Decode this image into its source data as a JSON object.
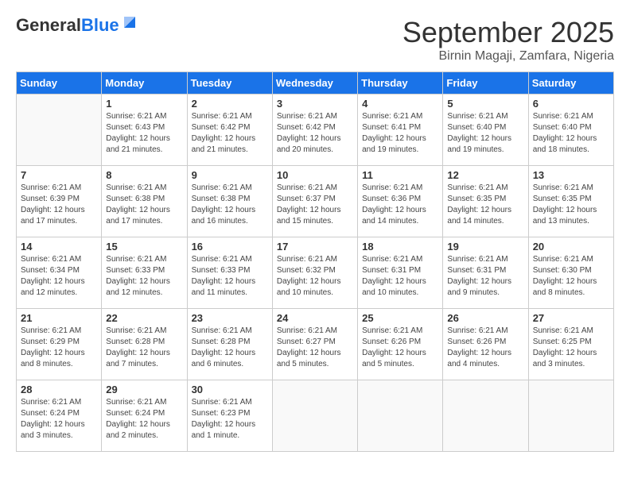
{
  "logo": {
    "line1": "General",
    "line2": "Blue"
  },
  "title": "September 2025",
  "subtitle": "Birnin Magaji, Zamfara, Nigeria",
  "weekdays": [
    "Sunday",
    "Monday",
    "Tuesday",
    "Wednesday",
    "Thursday",
    "Friday",
    "Saturday"
  ],
  "weeks": [
    [
      {
        "day": "",
        "info": ""
      },
      {
        "day": "1",
        "info": "Sunrise: 6:21 AM\nSunset: 6:43 PM\nDaylight: 12 hours\nand 21 minutes."
      },
      {
        "day": "2",
        "info": "Sunrise: 6:21 AM\nSunset: 6:42 PM\nDaylight: 12 hours\nand 21 minutes."
      },
      {
        "day": "3",
        "info": "Sunrise: 6:21 AM\nSunset: 6:42 PM\nDaylight: 12 hours\nand 20 minutes."
      },
      {
        "day": "4",
        "info": "Sunrise: 6:21 AM\nSunset: 6:41 PM\nDaylight: 12 hours\nand 19 minutes."
      },
      {
        "day": "5",
        "info": "Sunrise: 6:21 AM\nSunset: 6:40 PM\nDaylight: 12 hours\nand 19 minutes."
      },
      {
        "day": "6",
        "info": "Sunrise: 6:21 AM\nSunset: 6:40 PM\nDaylight: 12 hours\nand 18 minutes."
      }
    ],
    [
      {
        "day": "7",
        "info": "Sunrise: 6:21 AM\nSunset: 6:39 PM\nDaylight: 12 hours\nand 17 minutes."
      },
      {
        "day": "8",
        "info": "Sunrise: 6:21 AM\nSunset: 6:38 PM\nDaylight: 12 hours\nand 17 minutes."
      },
      {
        "day": "9",
        "info": "Sunrise: 6:21 AM\nSunset: 6:38 PM\nDaylight: 12 hours\nand 16 minutes."
      },
      {
        "day": "10",
        "info": "Sunrise: 6:21 AM\nSunset: 6:37 PM\nDaylight: 12 hours\nand 15 minutes."
      },
      {
        "day": "11",
        "info": "Sunrise: 6:21 AM\nSunset: 6:36 PM\nDaylight: 12 hours\nand 14 minutes."
      },
      {
        "day": "12",
        "info": "Sunrise: 6:21 AM\nSunset: 6:35 PM\nDaylight: 12 hours\nand 14 minutes."
      },
      {
        "day": "13",
        "info": "Sunrise: 6:21 AM\nSunset: 6:35 PM\nDaylight: 12 hours\nand 13 minutes."
      }
    ],
    [
      {
        "day": "14",
        "info": "Sunrise: 6:21 AM\nSunset: 6:34 PM\nDaylight: 12 hours\nand 12 minutes."
      },
      {
        "day": "15",
        "info": "Sunrise: 6:21 AM\nSunset: 6:33 PM\nDaylight: 12 hours\nand 12 minutes."
      },
      {
        "day": "16",
        "info": "Sunrise: 6:21 AM\nSunset: 6:33 PM\nDaylight: 12 hours\nand 11 minutes."
      },
      {
        "day": "17",
        "info": "Sunrise: 6:21 AM\nSunset: 6:32 PM\nDaylight: 12 hours\nand 10 minutes."
      },
      {
        "day": "18",
        "info": "Sunrise: 6:21 AM\nSunset: 6:31 PM\nDaylight: 12 hours\nand 10 minutes."
      },
      {
        "day": "19",
        "info": "Sunrise: 6:21 AM\nSunset: 6:31 PM\nDaylight: 12 hours\nand 9 minutes."
      },
      {
        "day": "20",
        "info": "Sunrise: 6:21 AM\nSunset: 6:30 PM\nDaylight: 12 hours\nand 8 minutes."
      }
    ],
    [
      {
        "day": "21",
        "info": "Sunrise: 6:21 AM\nSunset: 6:29 PM\nDaylight: 12 hours\nand 8 minutes."
      },
      {
        "day": "22",
        "info": "Sunrise: 6:21 AM\nSunset: 6:28 PM\nDaylight: 12 hours\nand 7 minutes."
      },
      {
        "day": "23",
        "info": "Sunrise: 6:21 AM\nSunset: 6:28 PM\nDaylight: 12 hours\nand 6 minutes."
      },
      {
        "day": "24",
        "info": "Sunrise: 6:21 AM\nSunset: 6:27 PM\nDaylight: 12 hours\nand 5 minutes."
      },
      {
        "day": "25",
        "info": "Sunrise: 6:21 AM\nSunset: 6:26 PM\nDaylight: 12 hours\nand 5 minutes."
      },
      {
        "day": "26",
        "info": "Sunrise: 6:21 AM\nSunset: 6:26 PM\nDaylight: 12 hours\nand 4 minutes."
      },
      {
        "day": "27",
        "info": "Sunrise: 6:21 AM\nSunset: 6:25 PM\nDaylight: 12 hours\nand 3 minutes."
      }
    ],
    [
      {
        "day": "28",
        "info": "Sunrise: 6:21 AM\nSunset: 6:24 PM\nDaylight: 12 hours\nand 3 minutes."
      },
      {
        "day": "29",
        "info": "Sunrise: 6:21 AM\nSunset: 6:24 PM\nDaylight: 12 hours\nand 2 minutes."
      },
      {
        "day": "30",
        "info": "Sunrise: 6:21 AM\nSunset: 6:23 PM\nDaylight: 12 hours\nand 1 minute."
      },
      {
        "day": "",
        "info": ""
      },
      {
        "day": "",
        "info": ""
      },
      {
        "day": "",
        "info": ""
      },
      {
        "day": "",
        "info": ""
      }
    ]
  ]
}
